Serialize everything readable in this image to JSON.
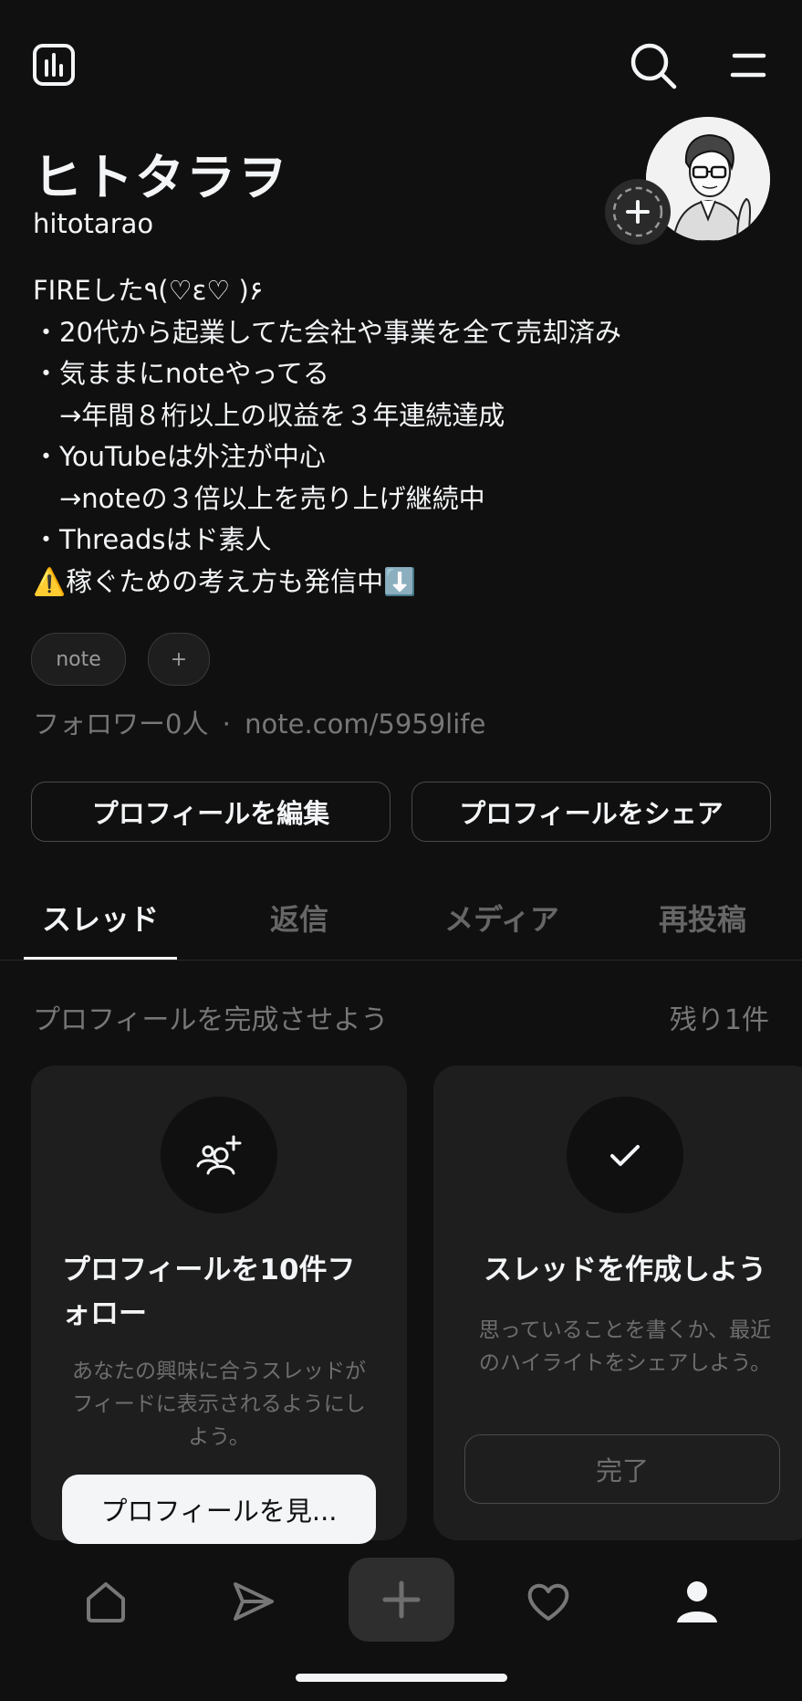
{
  "header": {
    "insights_icon": "bar-chart-icon",
    "search_icon": "search-icon",
    "menu_icon": "menu-icon"
  },
  "profile": {
    "name": "ヒトタラヲ",
    "handle": "hitotarao",
    "bio": "FIREした٩(♡ε♡ )۶\n・20代から起業してた会社や事業を全て売却済み\n・気ままにnoteやってる\n　→年間８桁以上の収益を３年連続達成\n・YouTubeは外注が中心\n　→noteの３倍以上を売り上げ継続中\n・Threadsはド素人\n⚠️稼ぐための考え方も発信中⬇️",
    "chips": [
      "note",
      "+"
    ],
    "followers": "フォロワー0人",
    "separator": "·",
    "link": "note.com/5959life",
    "edit_button": "プロフィールを編集",
    "share_button": "プロフィールをシェア"
  },
  "tabs": [
    {
      "label": "スレッド",
      "active": true
    },
    {
      "label": "返信",
      "active": false
    },
    {
      "label": "メディア",
      "active": false
    },
    {
      "label": "再投稿",
      "active": false
    }
  ],
  "completion": {
    "title": "プロフィールを完成させよう",
    "remaining": "残り1件",
    "cards": [
      {
        "icon": "add-people-icon",
        "title": "プロフィールを10件フォロー",
        "description": "あなたの興味に合うスレッドがフィードに表示されるようにしよう。",
        "button": "プロフィールを見..."
      },
      {
        "icon": "check-icon",
        "title": "スレッドを作成しよう",
        "description": "思っていることを書くか、最近のハイライトをシェアしよう。",
        "button": "完了"
      }
    ]
  },
  "bottom_nav": [
    "home-icon",
    "send-icon",
    "plus-icon",
    "heart-icon",
    "profile-icon"
  ],
  "colors": {
    "background": "#101010",
    "text": "#f3f5f7",
    "muted": "#777777",
    "card": "#1e1e1e"
  }
}
